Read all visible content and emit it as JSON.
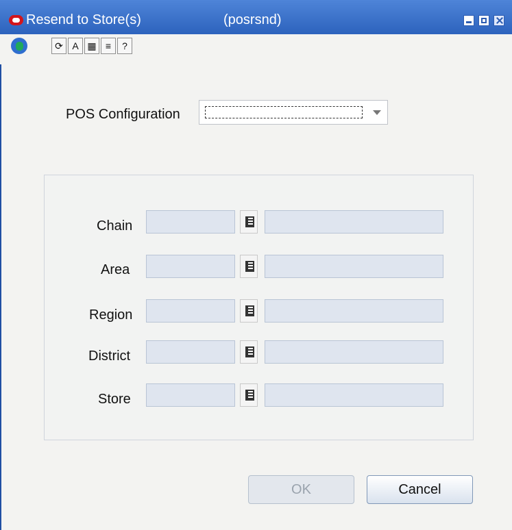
{
  "window": {
    "title": "Resend to Store(s)",
    "screen_code": "(posrsnd)"
  },
  "toolbar": {
    "buttons": [
      "globe-icon",
      "refresh-icon",
      "text-size-icon",
      "calendar-icon",
      "notes-icon",
      "help-icon"
    ]
  },
  "form": {
    "pos_configuration_label": "POS Configuration",
    "pos_configuration_value": "",
    "fields": [
      {
        "label": "Chain",
        "value": "",
        "description": ""
      },
      {
        "label": "Area",
        "value": "",
        "description": ""
      },
      {
        "label": "Region",
        "value": "",
        "description": ""
      },
      {
        "label": "District",
        "value": "",
        "description": ""
      },
      {
        "label": "Store",
        "value": "",
        "description": ""
      }
    ]
  },
  "buttons": {
    "ok": "OK",
    "cancel": "Cancel"
  },
  "colors": {
    "title_bar": "#2d63bd",
    "field_fill": "#dfe5ef"
  }
}
